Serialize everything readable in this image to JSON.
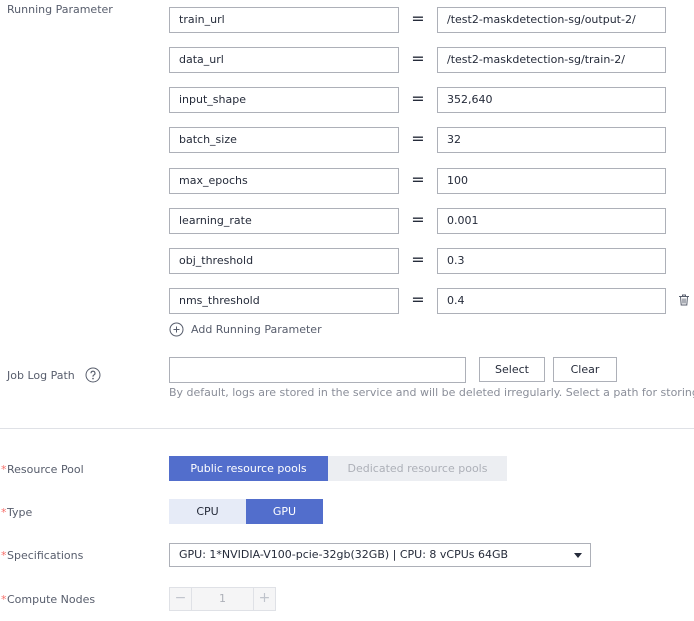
{
  "running_parameter": {
    "label": "Running Parameter",
    "params": [
      {
        "name": "train_url",
        "value": "/test2-maskdetection-sg/output-2/"
      },
      {
        "name": "data_url",
        "value": "/test2-maskdetection-sg/train-2/"
      },
      {
        "name": "input_shape",
        "value": "352,640"
      },
      {
        "name": "batch_size",
        "value": "32"
      },
      {
        "name": "max_epochs",
        "value": "100"
      },
      {
        "name": "learning_rate",
        "value": "0.001"
      },
      {
        "name": "obj_threshold",
        "value": "0.3"
      },
      {
        "name": "nms_threshold",
        "value": "0.4"
      }
    ],
    "equals": "=",
    "add_label": "Add Running Parameter"
  },
  "job_log": {
    "label": "Job Log Path",
    "path_value": "",
    "select_label": "Select",
    "clear_label": "Clear",
    "hint": "By default, logs are stored in the service and will be deleted irregularly. Select a path for storing logs."
  },
  "resource_pool": {
    "label": "Resource Pool",
    "options": [
      "Public resource pools",
      "Dedicated resource pools"
    ],
    "selected": "Public resource pools"
  },
  "type": {
    "label": "Type",
    "options": [
      "CPU",
      "GPU"
    ],
    "selected": "GPU"
  },
  "specifications": {
    "label": "Specifications",
    "value": "GPU: 1*NVIDIA-V100-pcie-32gb(32GB) | CPU: 8 vCPUs 64GB"
  },
  "compute_nodes": {
    "label": "Compute Nodes",
    "value": "1",
    "minus": "−",
    "plus": "+"
  },
  "colors": {
    "accent": "#526ecc",
    "required": "#f66f6a",
    "border": "#adb0b8"
  }
}
